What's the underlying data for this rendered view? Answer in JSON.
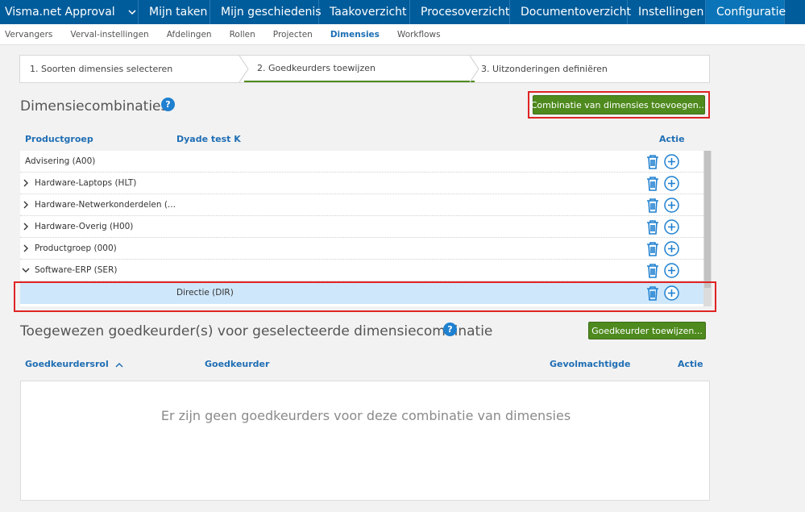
{
  "topnav": {
    "brand": "Visma.net Approval",
    "items": [
      "Mijn taken",
      "Mijn geschiedenis",
      "Taakoverzicht",
      "Procesoverzicht",
      "Documentoverzicht",
      "Instellingen",
      "Configuratie"
    ],
    "active": "Configuratie"
  },
  "subnav": {
    "items": [
      "Vervangers",
      "Verval-instellingen",
      "Afdelingen",
      "Rollen",
      "Projecten",
      "Dimensies",
      "Workflows"
    ],
    "active": "Dimensies"
  },
  "wizard": {
    "steps": [
      "1. Soorten dimensies selecteren",
      "2. Goedkeurders toewijzen",
      "3. Uitzonderingen definiëren"
    ],
    "active_step": 2
  },
  "combinations": {
    "title": "Dimensiecombinaties",
    "add_button": "Combinatie van dimensies toevoegen...",
    "columns": [
      "Productgroep",
      "Dyade test K",
      "Actie"
    ],
    "rows": [
      {
        "productgroep": "Advisering (A00)",
        "dyade": "",
        "expander": "none"
      },
      {
        "productgroep": "Hardware-Laptops (HLT)",
        "dyade": "",
        "expander": "collapsed"
      },
      {
        "productgroep": "Hardware-Netwerkonderdelen (...",
        "dyade": "",
        "expander": "collapsed"
      },
      {
        "productgroep": "Hardware-Overig (H00)",
        "dyade": "",
        "expander": "collapsed"
      },
      {
        "productgroep": "Productgroep (000)",
        "dyade": "",
        "expander": "collapsed"
      },
      {
        "productgroep": "Software-ERP (SER)",
        "dyade": "",
        "expander": "expanded"
      },
      {
        "productgroep": "",
        "dyade": "Directie (DIR)",
        "expander": "none",
        "selected": true
      }
    ]
  },
  "approvers": {
    "title": "Toegewezen goedkeurder(s) voor geselecteerde dimensiecombinatie",
    "assign_button": "Goedkeurder toewijzen...",
    "columns": [
      "Goedkeurdersrol",
      "Goedkeurder",
      "Gevolmachtigde",
      "Actie"
    ],
    "sort_column": "Goedkeurdersrol",
    "sort_direction": "ascending",
    "empty_message": "Er zijn geen goedkeurders voor deze combinatie van dimensies"
  },
  "help_label": "?",
  "colors": {
    "nav_bg": "#005c9b",
    "accent_blue": "#1f6eb4",
    "button_green": "#4e8a1e",
    "selected_row": "#cfe7fb",
    "highlight_red": "#e02424"
  },
  "icons": [
    "chevron-down-icon",
    "help-icon",
    "chevron-right-icon",
    "trash-icon",
    "add-circle-icon",
    "sort-up-icon"
  ]
}
